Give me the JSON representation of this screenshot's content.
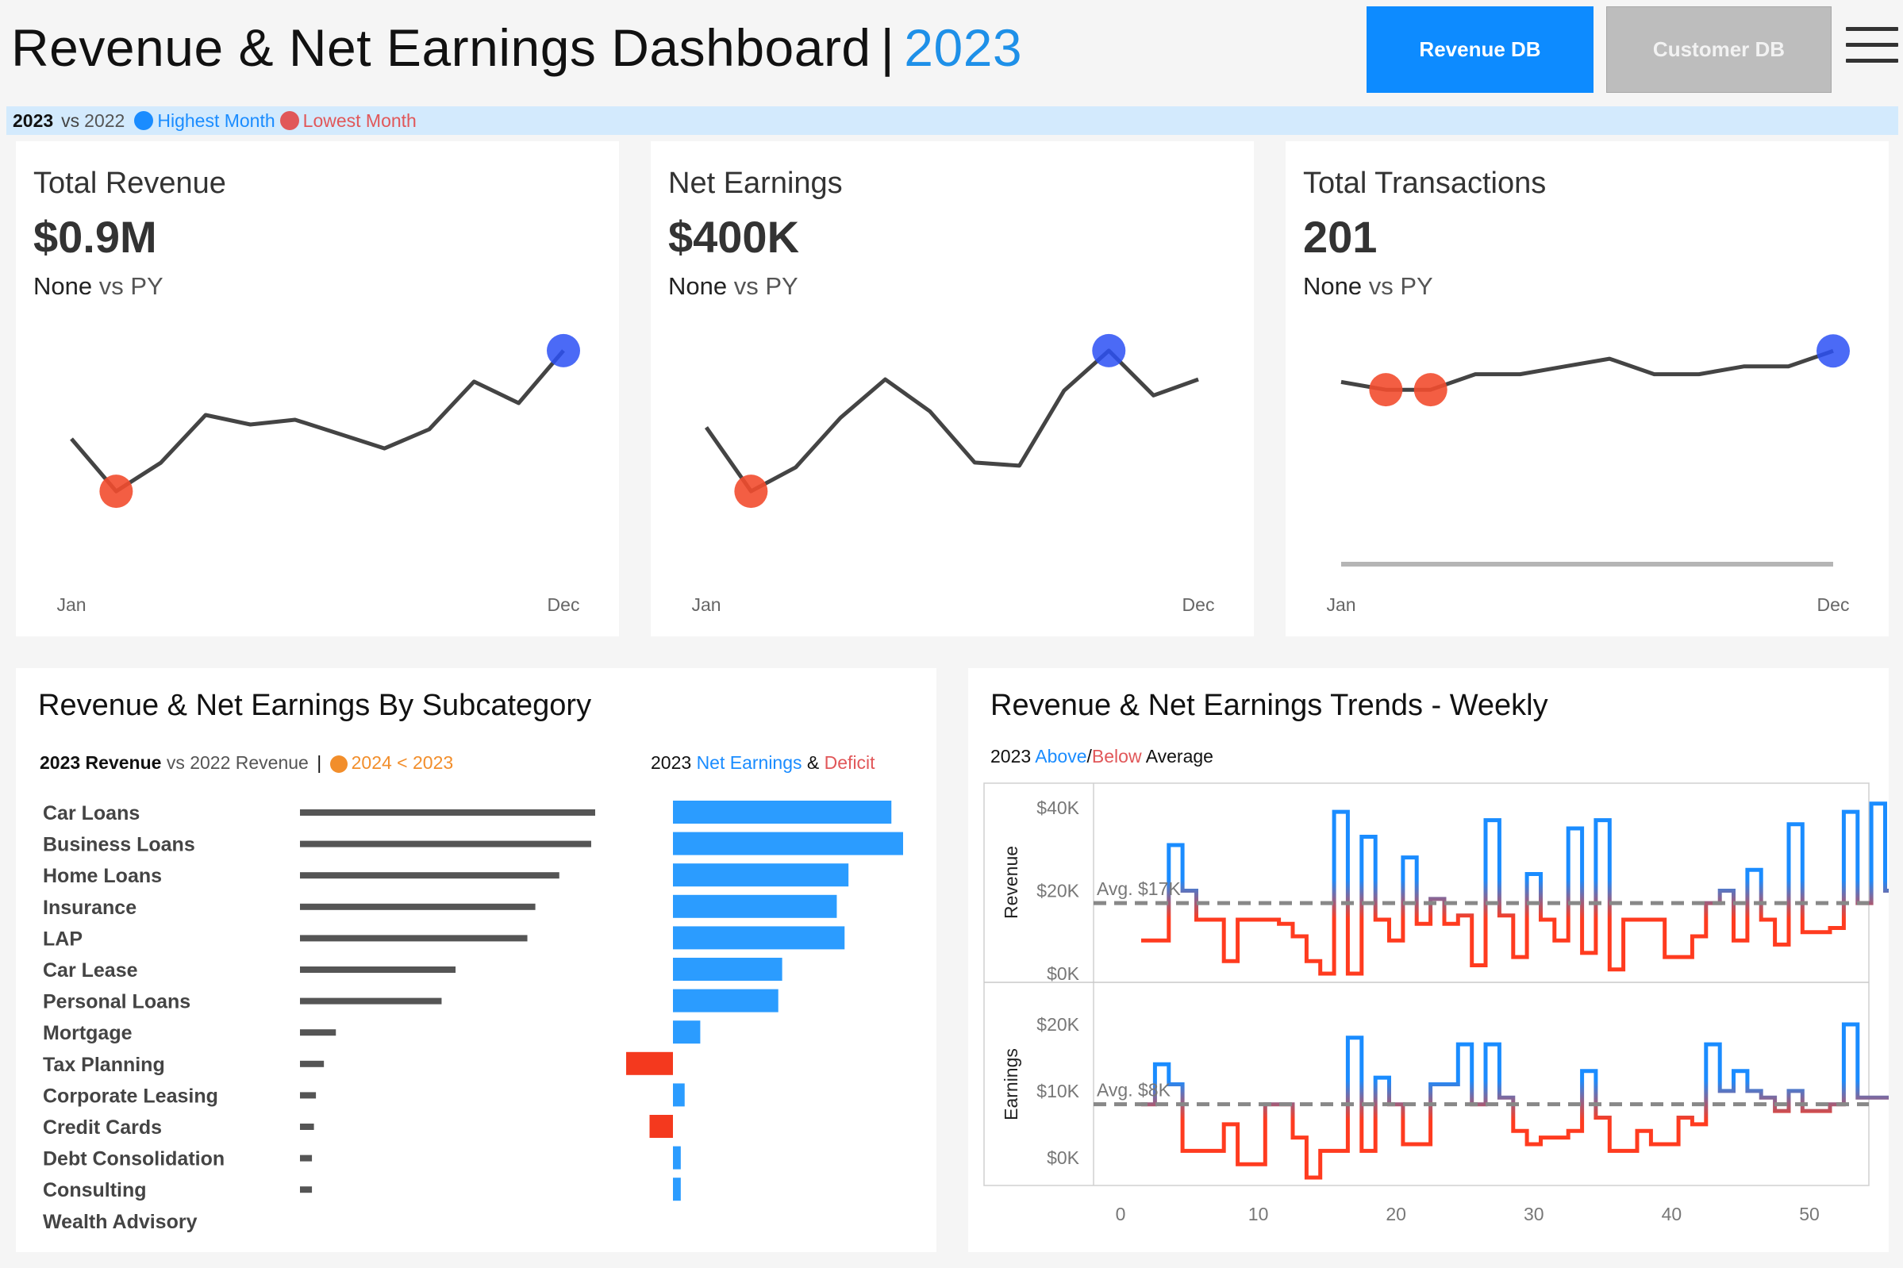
{
  "header": {
    "title": "Revenue & Net Earnings Dashboard",
    "separator": "|",
    "year": "2023",
    "revenue_btn": "Revenue DB",
    "customer_btn": "Customer DB"
  },
  "legend": {
    "current": "2023",
    "vs": "vs",
    "previous": "2022",
    "highest": "Highest Month",
    "lowest": "Lowest Month",
    "highest_color": "#1a8cff",
    "lowest_color": "#e15759"
  },
  "kpis": [
    {
      "title": "Total Revenue",
      "value": "$0.9M",
      "delta": "None",
      "vs": "vs PY",
      "x_start": "Jan",
      "x_end": "Dec",
      "series": [
        62,
        40,
        52,
        72,
        68,
        70,
        64,
        58,
        66,
        86,
        77,
        99
      ],
      "high": [
        11
      ],
      "low": [
        1
      ]
    },
    {
      "title": "Net Earnings",
      "value": "$400K",
      "delta": "None",
      "vs": "vs PY",
      "x_start": "Jan",
      "x_end": "Dec",
      "series": [
        50,
        10,
        25,
        56,
        80,
        60,
        28,
        26,
        73,
        98,
        70,
        80
      ],
      "high": [
        9
      ],
      "low": [
        1
      ]
    },
    {
      "title": "Total Transactions",
      "value": "201",
      "delta": "None",
      "vs": "vs PY",
      "x_start": "Jan",
      "x_end": "Dec",
      "series": [
        15,
        14,
        14,
        16,
        16,
        17,
        18,
        16,
        16,
        17,
        17,
        19
      ],
      "high": [
        11
      ],
      "low": [
        1,
        2
      ]
    }
  ],
  "subcategory": {
    "title": "Revenue & Net Earnings By Subcategory",
    "legend_left": {
      "a": "2023 Revenue",
      "b": "vs 2022 Revenue",
      "sep": "|",
      "c": "2024 < 2023",
      "c_color": "#f28e2b"
    },
    "legend_right": {
      "a": "2023",
      "b": "Net Earnings",
      "amp": "&",
      "c": "Deficit"
    },
    "categories": [
      "Car Loans",
      "Business Loans",
      "Home Loans",
      "Insurance",
      "LAP",
      "Car Lease",
      "Personal Loans",
      "Mortgage",
      "Tax Planning",
      "Corporate Leasing",
      "Credit Cards",
      "Debt Consolidation",
      "Consulting",
      "Wealth Advisory"
    ],
    "revenue": [
      148,
      146,
      130,
      118,
      114,
      78,
      71,
      18,
      12,
      8,
      7,
      6,
      6,
      0
    ],
    "net_earnings": [
      56,
      59,
      45,
      42,
      44,
      28,
      27,
      7,
      -12,
      3,
      -6,
      2,
      2,
      0
    ]
  },
  "weekly": {
    "title": "Revenue & Net Earnings Trends - Weekly",
    "legend": {
      "a": "2023",
      "b": "Above",
      "slash": "/",
      "c": "Below",
      "d": "Average"
    },
    "above_color": "#1a8cff",
    "below_color": "#ff3b1f",
    "revenue_label": "Revenue",
    "earnings_label": "Earnings",
    "revenue_ticks": [
      "$40K",
      "$20K",
      "$0K"
    ],
    "earnings_ticks": [
      "$20K",
      "$10K",
      "$0K"
    ],
    "revenue_avg_label": "Avg. $17K",
    "earnings_avg_label": "Avg. $8K",
    "revenue_avg": 17,
    "earnings_avg": 8,
    "revenue_ylim": [
      0,
      44
    ],
    "earnings_ylim": [
      -3,
      25
    ],
    "x_ticks": [
      "0",
      "10",
      "20",
      "30",
      "40",
      "50"
    ],
    "x_range": [
      0,
      54
    ],
    "revenue": [
      8,
      8,
      31,
      20,
      13,
      13,
      3,
      13,
      13,
      13,
      12,
      9,
      3,
      0,
      39,
      0,
      33,
      13,
      8,
      28,
      12,
      18,
      12,
      14,
      2,
      37,
      14,
      4,
      24,
      13,
      8,
      35,
      5,
      37,
      1,
      13,
      13,
      13,
      4,
      4,
      9,
      17,
      20,
      8,
      25,
      13,
      7,
      36,
      10,
      10,
      11,
      39,
      17,
      41,
      20,
      20,
      0
    ],
    "earnings": [
      8,
      14,
      11,
      1,
      1,
      1,
      5,
      -1,
      -1,
      8,
      8,
      3,
      -3,
      1,
      1,
      18,
      1,
      12,
      8,
      2,
      2,
      11,
      11,
      17,
      8,
      17,
      9,
      4,
      2,
      3,
      3,
      4,
      13,
      6,
      1,
      1,
      4,
      2,
      2,
      6,
      5,
      17,
      10,
      13,
      10,
      9,
      7,
      10,
      7,
      7,
      8,
      20,
      9,
      9,
      9,
      1,
      1
    ],
    "x_start": 1.5
  }
}
